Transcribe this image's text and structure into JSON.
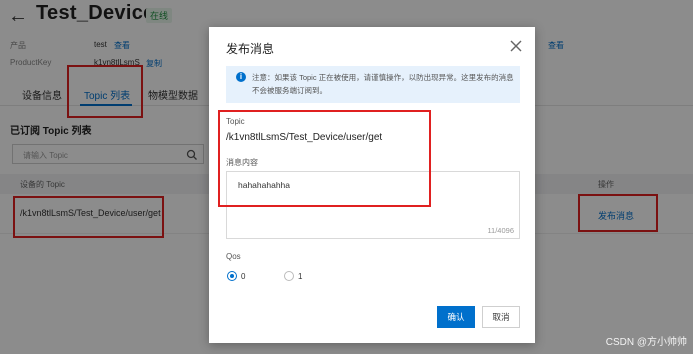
{
  "header": {
    "back_icon": "arrow-left-icon",
    "device_name": "Test_Device",
    "status": "在线",
    "product_label": "产品",
    "product_value": "test",
    "product_link": "查看",
    "productkey_label": "ProductKey",
    "productkey_value": "k1vn8tlLsmS",
    "copy_link": "复制",
    "right_link": "查看"
  },
  "tabs": [
    {
      "label": "设备信息",
      "active": false
    },
    {
      "label": "Topic 列表",
      "active": true
    },
    {
      "label": "物模型数据",
      "active": false
    }
  ],
  "section": {
    "title": "已订阅 Topic 列表",
    "search_placeholder": "请输入 Topic"
  },
  "table": {
    "columns": [
      "设备的 Topic",
      "操作"
    ],
    "rows": [
      {
        "topic": "/k1vn8tlLsmS/Test_Device/user/get",
        "action": "发布消息"
      }
    ]
  },
  "modal": {
    "title": "发布消息",
    "notice": "注意：如果该 Topic 正在被使用，请谨慎操作，以防出现异常。这里发布的消息不会被服务端订阅到。",
    "topic_label": "Topic",
    "topic_value": "/k1vn8tlLsmS/Test_Device/user/get",
    "message_label": "消息内容",
    "message_value": "hahahahahha",
    "char_count": "11/4096",
    "qos_label": "Qos",
    "qos_options": [
      {
        "label": "0",
        "checked": true
      },
      {
        "label": "1",
        "checked": false
      }
    ],
    "confirm_label": "确认",
    "cancel_label": "取消"
  },
  "watermark": "CSDN @方小帅帅",
  "colors": {
    "accent": "#0070cc",
    "highlight": "#e02020",
    "online": "#1e8e3e"
  }
}
